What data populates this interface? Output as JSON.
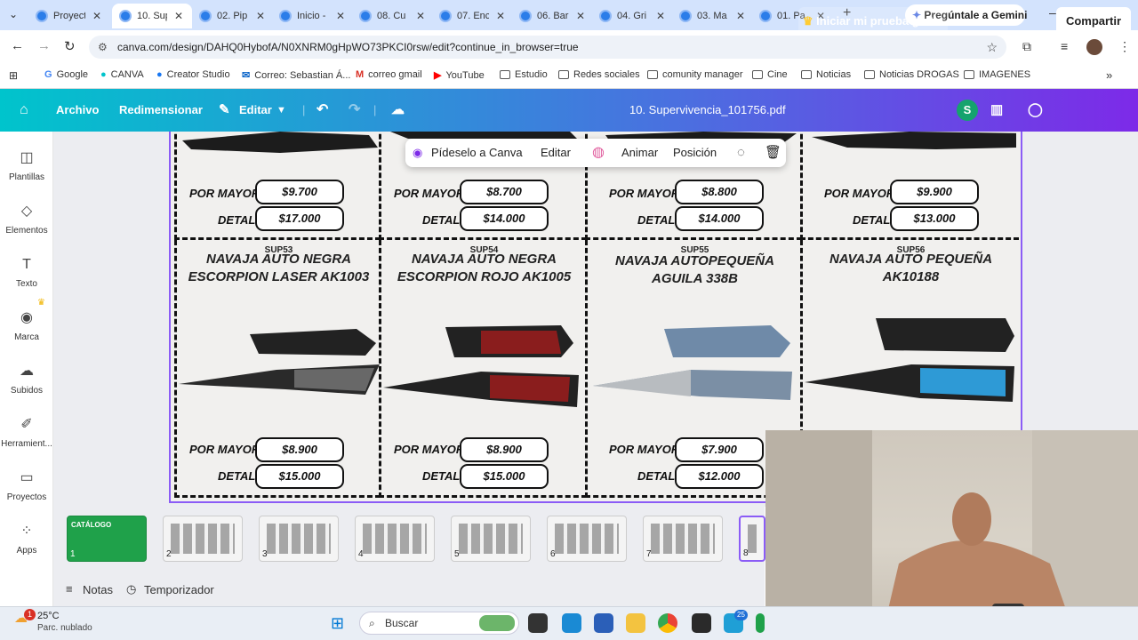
{
  "browser": {
    "tabs": [
      {
        "title": "Proyect",
        "active": false
      },
      {
        "title": "10. Sup",
        "active": true
      },
      {
        "title": "02. Pip",
        "active": false
      },
      {
        "title": "Inicio -",
        "active": false
      },
      {
        "title": "08. Cu",
        "active": false
      },
      {
        "title": "07. Enc",
        "active": false
      },
      {
        "title": "06. Bar",
        "active": false
      },
      {
        "title": "04. Gri",
        "active": false
      },
      {
        "title": "03. Ma",
        "active": false
      },
      {
        "title": "01. Pa",
        "active": false
      }
    ],
    "gemini_label": "Pregúntale a Gemini",
    "url": "canva.com/design/DAHQ0HybofA/N0XNRM0gHpWO73PKCI0rsw/edit?continue_in_browser=true",
    "bookmarks": [
      "Google",
      "CANVA",
      "Creator Studio",
      "Correo: Sebastian Á...",
      "correo gmail",
      "YouTube",
      "Estudio",
      "Redes sociales",
      "comunity manager",
      "Cine",
      "Noticias",
      "Noticias DROGAS",
      "IMAGENES"
    ]
  },
  "canva": {
    "header": {
      "archivo": "Archivo",
      "redimensionar": "Redimensionar",
      "editar": "Editar",
      "doc_title": "10. Supervivencia_101756.pdf",
      "trial": "Iniciar mi prueba gratis",
      "avatar": "S",
      "share": "Compartir"
    },
    "sidebar": [
      "Plantillas",
      "Elementos",
      "Texto",
      "Marca",
      "Subidos",
      "Herramient...",
      "Proyectos",
      "Apps"
    ],
    "floating_toolbar": {
      "ask": "Pídeselo a Canva",
      "edit": "Editar",
      "animate": "Animar",
      "position": "Posición"
    },
    "top_row": [
      {
        "por_mayor": "$9.700",
        "detal": "$17.000"
      },
      {
        "por_mayor": "$8.700",
        "detal": "$14.000"
      },
      {
        "por_mayor": "$8.800",
        "detal": "$14.000"
      },
      {
        "por_mayor": "$9.900",
        "detal": "$13.000"
      }
    ],
    "bottom_row": [
      {
        "code": "SUP53",
        "name1": "NAVAJA AUTO NEGRA",
        "name2": "ESCORPION LASER AK1003",
        "por_mayor": "$8.900",
        "detal": "$15.000",
        "handle": "#2b2b2b"
      },
      {
        "code": "SUP54",
        "name1": "NAVAJA AUTO NEGRA",
        "name2": "ESCORPION ROJO AK1005",
        "por_mayor": "$8.900",
        "detal": "$15.000",
        "handle": "#8a1d1d"
      },
      {
        "code": "SUP55",
        "name1": "NAVAJA AUTOPEQUEÑA",
        "name2": "AGUILA 338B",
        "por_mayor": "$7.900",
        "detal": "$12.000",
        "handle": "#6f8aa8"
      },
      {
        "code": "SUP56",
        "name1": "NAVAJA AUTO PEQUEÑA",
        "name2": "AK10188",
        "por_mayor": "",
        "detal": "",
        "handle": "#2e9ad6"
      }
    ],
    "labels": {
      "por_mayor": "POR MAYOR",
      "detal": "DETAL"
    },
    "thumbnails": [
      "1",
      "2",
      "3",
      "4",
      "5",
      "6",
      "7",
      "8"
    ],
    "thumb1_title": "CATÁLOGO",
    "notes": "Notas",
    "timer": "Temporizador"
  },
  "taskbar": {
    "temp": "25°C",
    "weather": "Parc. nublado",
    "search": "Buscar",
    "badge": "25"
  }
}
